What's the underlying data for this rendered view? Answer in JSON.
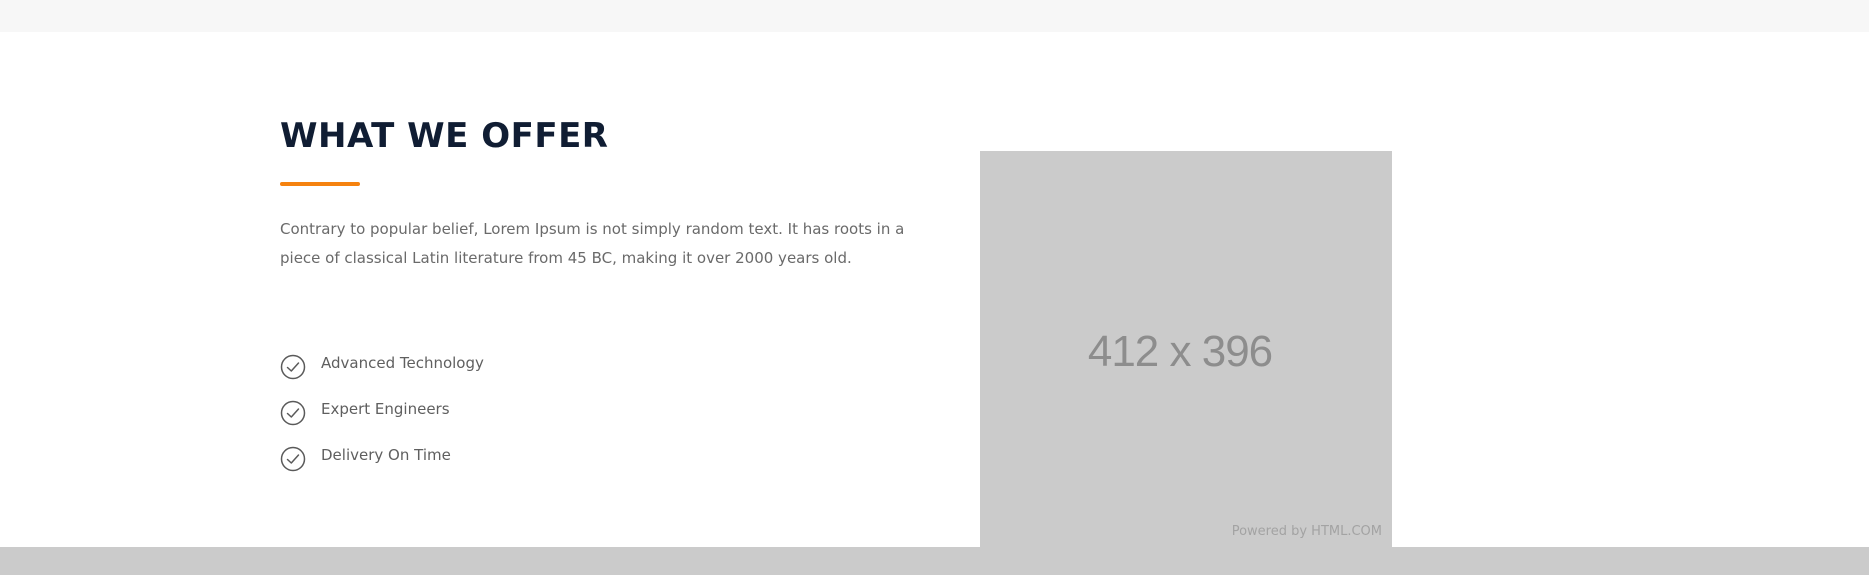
{
  "section": {
    "heading": "WHAT WE OFFER",
    "description": "Contrary to popular belief, Lorem Ipsum is not simply random text. It has roots in a piece of classical Latin literature from 45 BC, making it over 2000 years old.",
    "features": [
      {
        "label": "Advanced Technology",
        "icon": "check-circle-icon"
      },
      {
        "label": "Expert Engineers",
        "icon": "check-circle-icon"
      },
      {
        "label": "Delivery On Time",
        "icon": "check-circle-icon"
      }
    ]
  },
  "image_placeholder": {
    "size_text": "412 x 396",
    "credit": "Powered by HTML.COM"
  },
  "colors": {
    "accent": "#f5820f",
    "heading": "#101d33",
    "body_text": "#6a6a6a",
    "placeholder_bg": "#cbcbcb",
    "top_strip": "#f7f7f7",
    "bottom_strip": "#cbcbcb"
  }
}
